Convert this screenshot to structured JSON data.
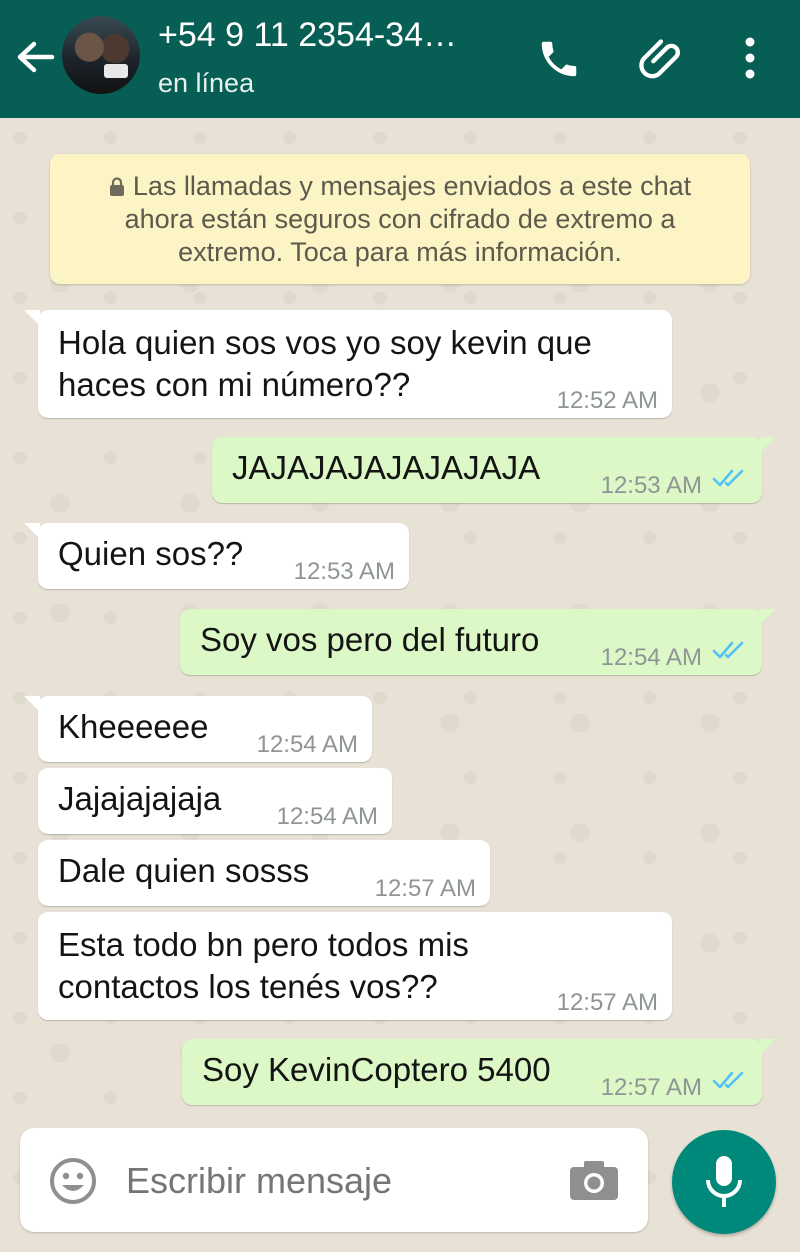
{
  "header": {
    "contact_name": "+54 9 11 2354-34…",
    "status": "en línea",
    "color": "#075e54"
  },
  "notice": {
    "line1": "Las llamadas y mensajes enviados a este chat",
    "line2": "ahora están seguros con cifrado de extremo a",
    "line3": "extremo. Toca para más información."
  },
  "messages": [
    {
      "dir": "in",
      "lines": [
        "Hola quien sos vos yo soy kevin que",
        "haces con mi número??"
      ],
      "time": "12:52 AM"
    },
    {
      "dir": "out",
      "text": "JAJAJAJAJAJAJAJA",
      "time": "12:53 AM",
      "status": "read"
    },
    {
      "dir": "in",
      "text": "Quien sos??",
      "time": "12:53 AM"
    },
    {
      "dir": "out",
      "text": "Soy vos pero del futuro",
      "time": "12:54 AM",
      "status": "read"
    },
    {
      "dir": "in",
      "text": "Kheeeeee",
      "time": "12:54 AM"
    },
    {
      "dir": "in",
      "text": "Jajajajajaja",
      "time": "12:54 AM"
    },
    {
      "dir": "in",
      "text": "Dale quien sosss",
      "time": "12:57 AM"
    },
    {
      "dir": "in",
      "lines": [
        "Esta todo bn pero todos mis",
        "contactos los tenés vos??"
      ],
      "time": "12:57 AM"
    },
    {
      "dir": "out",
      "text": "Soy KevinCoptero 5400",
      "time": "12:57 AM",
      "status": "read"
    }
  ],
  "composer": {
    "placeholder": "Escribir mensaje"
  },
  "icons": {
    "back": "arrow-left-icon",
    "phone": "phone-icon",
    "attach": "paperclip-icon",
    "menu": "more-vertical-icon",
    "emoji": "emoji-icon",
    "camera": "camera-icon",
    "mic": "microphone-icon",
    "lock": "lock-icon",
    "read": "double-check-icon"
  },
  "colors": {
    "outgoing_bubble": "#dcf8c6",
    "incoming_bubble": "#ffffff",
    "read_ticks": "#4fc3f7",
    "mic_button": "#00897b"
  }
}
